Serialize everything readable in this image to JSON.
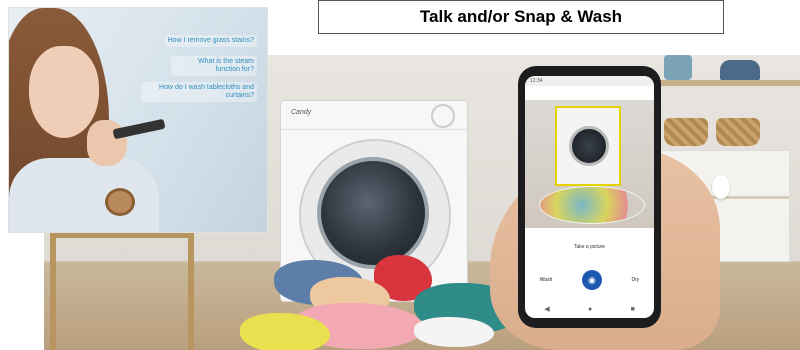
{
  "banner": {
    "title": "Talk and/or Snap & Wash"
  },
  "inset": {
    "questions": [
      "How I remove grass stains?",
      "What is the steam function for?",
      "How do I wash tablecloths and curtains?"
    ]
  },
  "washer": {
    "brand_text": "Candy"
  },
  "phone": {
    "status_left": "12:34",
    "status_right": "",
    "screen_label": "Take a picture",
    "left_button": "Wash",
    "right_button": "Dry",
    "shutter_icon": "camera-icon"
  },
  "colors": {
    "question_text": "#2f8fbf",
    "scan_frame": "#e5d200",
    "shutter": "#1b5ab0"
  }
}
